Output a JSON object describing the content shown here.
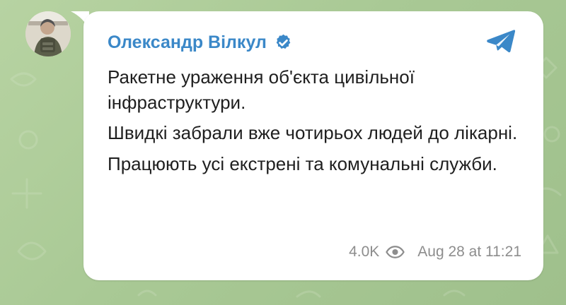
{
  "post": {
    "author_name": "Олександр Вілкул",
    "message_lines": [
      "Ракетне ураження об'єкта цивільної інфраструктури.",
      "Швидкі забрали вже чотирьох людей до лікарні.",
      "Працюють усі екстрені та комунальні служби."
    ],
    "views": "4.0K",
    "timestamp": "Aug 28 at 11:21"
  },
  "icons": {
    "verified": "verified-badge-icon",
    "telegram": "telegram-logo-icon",
    "views": "eye-icon"
  },
  "colors": {
    "background_green": "#a9c995",
    "author_blue": "#3b88c8",
    "text_dark": "#1f1f1f",
    "meta_gray": "#8d8d8d",
    "bubble_white": "#ffffff"
  }
}
